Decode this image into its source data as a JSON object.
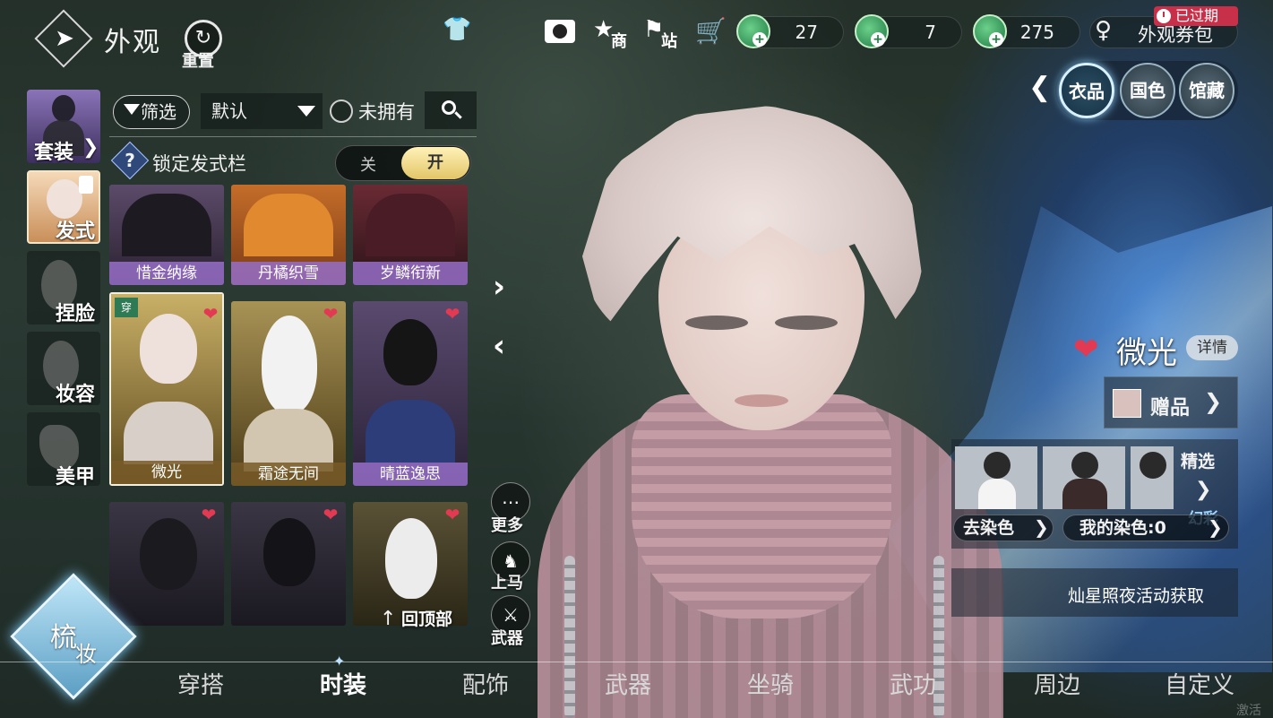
{
  "header": {
    "title": "外观",
    "reset_label": "重置"
  },
  "topbar": {
    "icons": [
      "outfit-icon",
      "camera-icon",
      "shop-icon",
      "station-icon",
      "cart-icon"
    ],
    "shop_label": "商",
    "station_label": "站",
    "currencies": [
      {
        "icon": "jade-coin-icon",
        "value": "27"
      },
      {
        "icon": "jade-coin-icon",
        "value": "7"
      },
      {
        "icon": "jade-coin-icon",
        "value": "275"
      }
    ],
    "voucher_label": "外观券包",
    "expired_badge": "已过期"
  },
  "right_tabs": [
    "衣品",
    "国色",
    "馆藏"
  ],
  "categories": [
    {
      "label": "套装"
    },
    {
      "label": "发式"
    },
    {
      "label": "捏脸"
    },
    {
      "label": "妆容"
    },
    {
      "label": "美甲"
    }
  ],
  "filter": {
    "filter_label": "筛选",
    "sort_value": "默认",
    "unowned_label": "未拥有"
  },
  "lock": {
    "label": "锁定发式栏",
    "off": "关",
    "on": "开"
  },
  "items": {
    "row1": [
      "惜金纳缘",
      "丹橘织雪",
      "岁鳞衔新"
    ],
    "row2": [
      "微光",
      "霜途无间",
      "晴蓝逸思"
    ],
    "new_badge": "穿"
  },
  "back_to_top": "回顶部",
  "mid_buttons": {
    "more": "更多",
    "mount": "上马",
    "weapon": "武器"
  },
  "big_button": {
    "line1": "梳",
    "line2": "妆"
  },
  "detail": {
    "name": "微光",
    "detail_btn": "详情",
    "gift": "赠品",
    "pick": "精选",
    "rainbow": "幻彩",
    "go_dye": "去染色",
    "my_dye": "我的染色:0",
    "source": "灿星照夜活动获取"
  },
  "bottom_nav": [
    "穿搭",
    "时装",
    "配饰",
    "武器",
    "坐骑",
    "武功",
    "周边",
    "自定义"
  ],
  "active_nav": "时装",
  "watermark": "激活",
  "colors": {
    "accent_heart": "#e23a52",
    "label_purple": "#966ec8",
    "toggle_gold": "#e2c567",
    "expired_red": "#c8304a"
  }
}
